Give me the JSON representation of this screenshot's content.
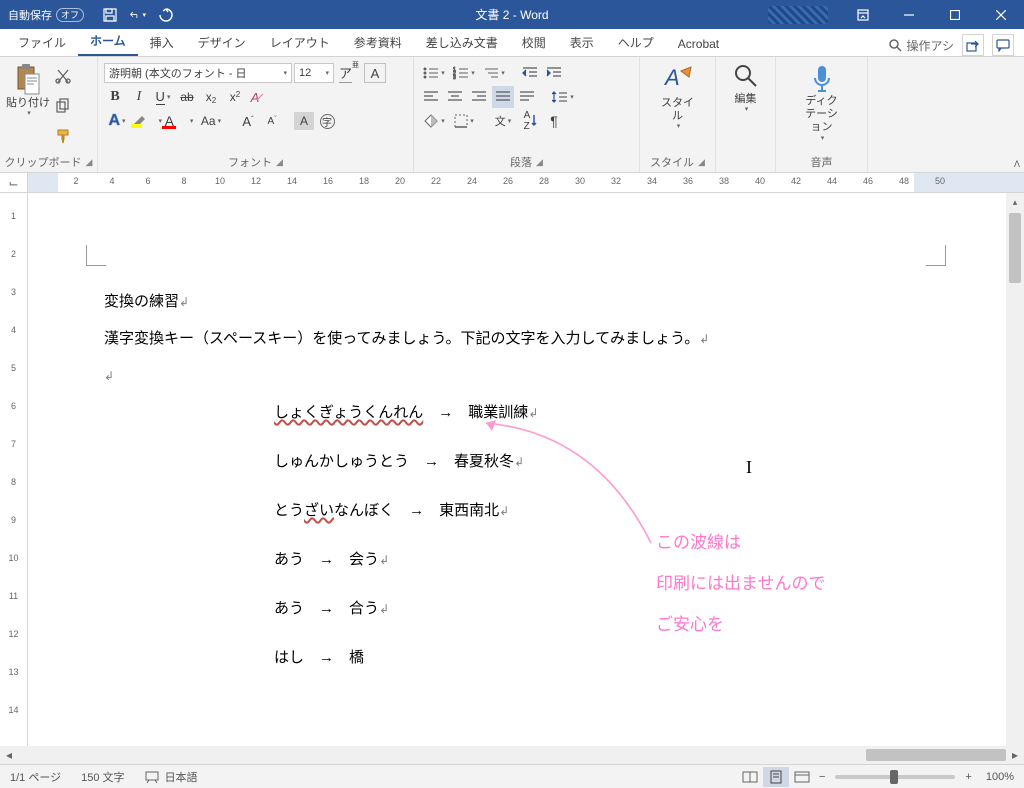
{
  "title_bar": {
    "autosave_label": "自動保存",
    "autosave_state": "オフ",
    "doc_title": "文書 2  -  Word"
  },
  "tabs": {
    "file": "ファイル",
    "home": "ホーム",
    "insert": "挿入",
    "design": "デザイン",
    "layout": "レイアウト",
    "references": "参考資料",
    "mailings": "差し込み文書",
    "review": "校閲",
    "view": "表示",
    "help": "ヘルプ",
    "acrobat": "Acrobat",
    "tell_me": "操作アシ"
  },
  "ribbon": {
    "clipboard": {
      "label": "クリップボード",
      "paste": "貼り付け"
    },
    "font": {
      "label": "フォント",
      "name": "游明朝 (本文のフォント - 日",
      "size": "12"
    },
    "paragraph": {
      "label": "段落"
    },
    "styles": {
      "label": "スタイル",
      "btn": "スタイル"
    },
    "editing": {
      "label": "編集",
      "btn": "編集"
    },
    "voice": {
      "label": "音声",
      "btn": "ディクテーション"
    }
  },
  "document": {
    "title_line": "変換の練習",
    "intro": "漢字変換キー（スペースキー）を使ってみましょう。下記の文字を入力してみましょう。",
    "lines": [
      {
        "kana": "しょくぎょうくんれん",
        "arrow": "→",
        "kanji": "職業訓練",
        "wave": true
      },
      {
        "kana": "しゅんかしゅうとう",
        "arrow": "→",
        "kanji": "春夏秋冬",
        "wave": false
      },
      {
        "kana": "とうざいなんぼく",
        "arrow": "→",
        "kanji": "東西南北",
        "wave_partial": "ざい"
      },
      {
        "kana": "あう",
        "arrow": "→",
        "kanji": "会う",
        "wave": false
      },
      {
        "kana": "あう",
        "arrow": "→",
        "kanji": "合う",
        "wave": false
      },
      {
        "kana": "はし",
        "arrow": "→",
        "kanji": "橋",
        "wave": false
      }
    ]
  },
  "annotation": {
    "l1": "この波線は",
    "l2": "印刷には出ませんので",
    "l3": "ご安心を"
  },
  "status": {
    "page": "1/1 ページ",
    "words": "150 文字",
    "lang": "日本語",
    "zoom": "100%"
  }
}
